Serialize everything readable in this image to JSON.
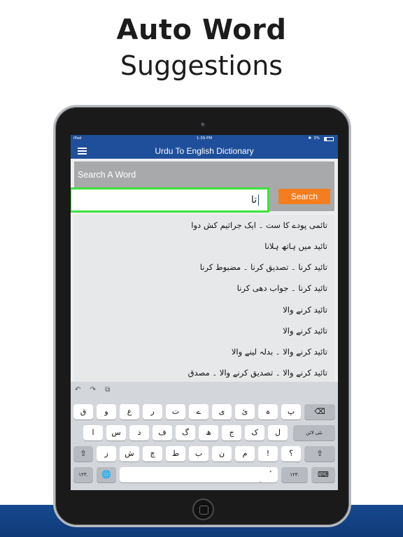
{
  "promo": {
    "title_line1": "Auto Word",
    "title_line2": "Suggestions"
  },
  "status_bar": {
    "carrier": "iPad",
    "time": "1:39 PM",
    "battery": "3%",
    "bt": "✱"
  },
  "app_bar": {
    "title": "Urdu To English Dictionary",
    "menu_icon": "hamburger-menu-icon"
  },
  "search": {
    "label": "Search A Word",
    "input_value": "تا",
    "button_label": "Search"
  },
  "results": [
    "تائمی پودے کا ست ۔ ایک جراثیم کش دوا",
    "تائید میں ہاتھ ہلانا",
    "تائید کرنا ۔ تصدیق کرنا ۔ مضبوط کرنا",
    "تائید کرنا ۔ جواب دھی کرنا",
    "تائید کرنے والا",
    "تائید کرنے والا",
    "تائید کرنے والا ۔ بدلہ لینے والا",
    "تائید کرنے والا ۔ تصدیق کرنے والا ۔ مصدق"
  ],
  "keyboard": {
    "toolbar": [
      "↶",
      "↷",
      "⧉"
    ],
    "row1": [
      "ق",
      "و",
      "ع",
      "ر",
      "ت",
      "ے",
      "ی",
      "ئ",
      "ہ",
      "پ"
    ],
    "backspace_icon": "⌫",
    "row2": [
      "ا",
      "س",
      "د",
      "ف",
      "گ",
      "ھ",
      "ج",
      "ک",
      "ل"
    ],
    "return_label": "نئی لائن",
    "row3": [
      "ز",
      "ش",
      "چ",
      "ط",
      "ب",
      "ن",
      "م",
      "!",
      "؟"
    ],
    "shift_icon": "⇧",
    "numbers_label": "۱۲۳.",
    "globe_icon": "🌐",
    "space_label": "",
    "special_key": "ٔ",
    "hide_icon": "⌨"
  }
}
